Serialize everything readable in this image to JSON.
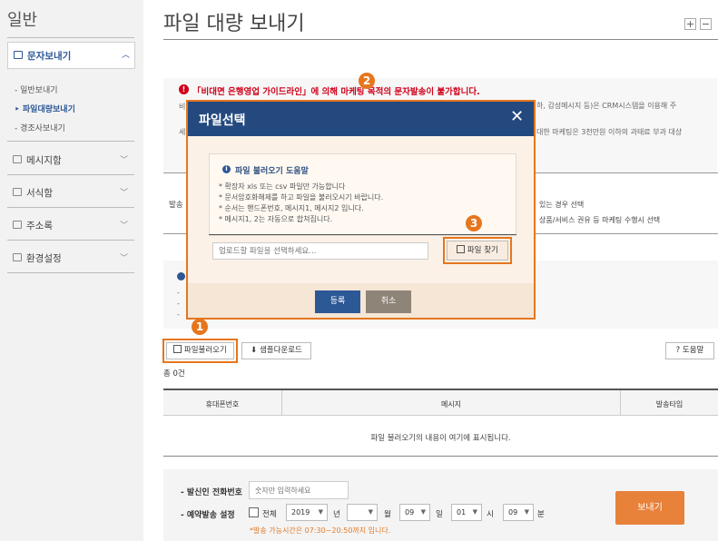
{
  "sidebar": {
    "title": "일반",
    "active_menu": "문자보내기",
    "sub_items": [
      "일반보내기",
      "파일대량보내기",
      "경조사보내기"
    ],
    "menus": [
      "메시지함",
      "서식함",
      "주소록",
      "환경설정"
    ]
  },
  "header": {
    "title": "파일 대량 보내기",
    "plus": "+",
    "minus": "−"
  },
  "notice": {
    "warning": "「비대면 은행영업 가이드라인」에 의해 마케팅 목적의 문자발송이 불가합니다.",
    "line1_prefix": "비",
    "line1_tail": "하, 감성메시지 등)은 CRM시스템을 이용해 주",
    "line2_prefix": "세",
    "line2_tail": "대한 마케팅은 3천만원 이하의 과태료 부과 대상"
  },
  "section2": {
    "left_prefix": "발송",
    "right1": "있는 경우 선택",
    "right2": "상품/서비스 권유 등 마케팅 수행시 선택"
  },
  "section3": {
    "dashes": [
      "-",
      "-",
      "-"
    ]
  },
  "toolbar": {
    "file_load": "파일불러오기",
    "sample_download": "샘플다운로드",
    "help": "도움말"
  },
  "summary": {
    "total": "총 0건"
  },
  "table": {
    "headers": [
      "휴대폰번호",
      "메시지",
      "발송타입"
    ],
    "empty_message": "파일 불러오기의 내용이 여기에 표시됩니다."
  },
  "form": {
    "sender_label": "- 발신인 전화번호",
    "sender_placeholder": "숫자만 입력하세요",
    "schedule_label": "- 예약발송 설정",
    "all_label": "전체",
    "year_value": "2019",
    "year_unit": "년",
    "month_value": "",
    "month_unit": "월",
    "day_value": "09",
    "day_unit": "일",
    "hour_value": "01",
    "hour_unit": "시",
    "minute_value": "09",
    "minute_unit": "분",
    "note": "*발송 가능시간은 07:30~20:50까지 입니다.",
    "send": "보내기"
  },
  "modal": {
    "title": "파일선택",
    "help_title": "파일 불러오기 도움말",
    "bullets": [
      "* 확장자 xls 또는 csv 파일만 가능합니다",
      "* 문서암호화해제를 하고 파일을 불러오시기 바랍니다.",
      "* 순서는 핸드폰번호, 메시지1, 메시지2 입니다.",
      "* 메시지1, 2는 자동으로 합쳐집니다."
    ],
    "input_placeholder": "업로드할 파일을 선택하세요...",
    "find_file": "파일 찾기",
    "confirm": "등록",
    "cancel": "취소"
  },
  "badges": [
    "1",
    "2",
    "3"
  ],
  "colors": {
    "accent": "#e6761e",
    "modal_header": "#23497f",
    "warning": "#d0021b"
  }
}
